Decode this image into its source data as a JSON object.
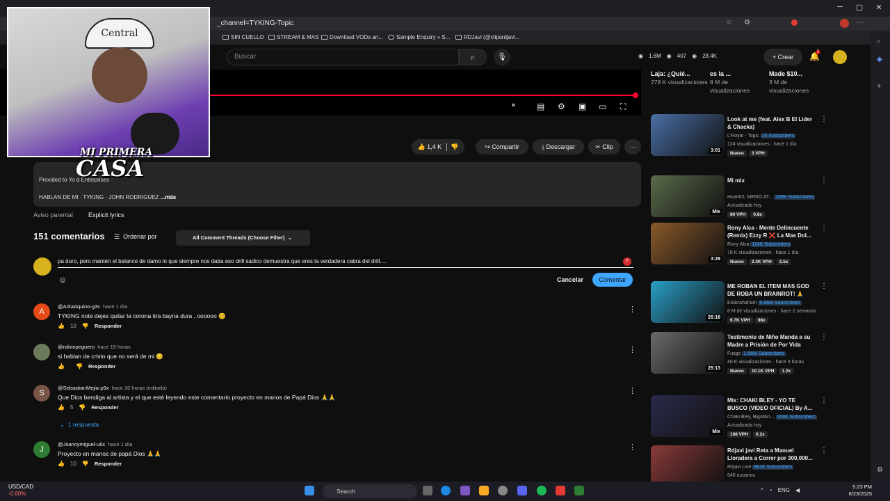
{
  "browser": {
    "url": "_channel=TYKING-Topic",
    "bookmarks": [
      "SIN CUELLO",
      "STREAM & MAS",
      "Download VODs an...",
      "Sample Enquiry » S...",
      "RDJavi (@clipsrdjavi..."
    ]
  },
  "header": {
    "search_placeholder": "Buscar",
    "stats": [
      "1.6M",
      "407",
      "28.4K"
    ],
    "create_label": "Crear",
    "notif_count": "5"
  },
  "actions": {
    "likes": "1,4 K",
    "share": "Compartir",
    "download": "Descargar",
    "clip": "Clip"
  },
  "description": {
    "line1": "Provided to Yo                                          d Enterprises",
    "line2": "HABLAN DE MI · TYKING · JOHN RODRIGUEZ",
    "more": "...más"
  },
  "overlay": {
    "line1": "MI PRIMERA",
    "line2": "CASA",
    "cap_text": "Central"
  },
  "aviso": "Aviso parental",
  "explicit": "Explicit lyrics",
  "comments": {
    "count_label": "151 comentarios",
    "order_label": "Ordenar por",
    "filter_label": "All Comment Threads (Choose Filter)",
    "draft": "pa duro, pero manten el balance de damo lo que siempre nos daba eso drill sadico demuestra que eres la verdadera cabra del drill....",
    "draft_badge": "7",
    "cancel": "Cancelar",
    "submit": "Comentar",
    "reply_label": "Responder",
    "replies_toggle": "1 respuesta",
    "items": [
      {
        "initial": "A",
        "color": "#e64a19",
        "user": "@AritaAquino-g3v",
        "time": "hace 1 día",
        "text": "TYKING note dejes quitar la corona tira bayna dura , oooooo 😊",
        "likes": "10"
      },
      {
        "initial": "",
        "color": "#6b7a5a",
        "user": "@ralvinpeguero",
        "time": "hace 15 horas",
        "text": "si hablan de cristo que no será de mi 😊",
        "likes": ""
      },
      {
        "initial": "S",
        "color": "#795548",
        "user": "@SebastianMejia-p9x",
        "time": "hace 20 horas (editado)",
        "text": "Que Dios bendiga al artista y el que esté leyendo este comentario proyecto en manos de Papá Dios 🙏🙏",
        "likes": "5"
      },
      {
        "initial": "J",
        "color": "#2e7d32",
        "user": "@Joancymiguel-u6x",
        "time": "hace 1 día",
        "text": "Proyecto en manos de papá Dios 🙏🙏",
        "likes": "10"
      }
    ]
  },
  "recommendations_top": [
    {
      "title": "Laja: ¿Quié...",
      "views": "278 K visualizaciones"
    },
    {
      "title": "es la ...",
      "views": "8 M de visualizaciones"
    },
    {
      "title": "Made $10...",
      "views": "3 M de visualizaciones"
    }
  ],
  "recommendations": [
    {
      "title": "Look at me (feat. Alex B El Lider & Chacka)",
      "channel": "L'Royal - Topic",
      "subs": "20 Subscribers",
      "meta": "124 visualizaciones · hace 1 día",
      "duration": "3:01",
      "badges": [
        "Nuevo",
        "3 VPH"
      ],
      "color": "#4a6fa5"
    },
    {
      "title": "Mi mix",
      "channel": "Huan62, MEMO AT...",
      "subs": "109K Subscribers",
      "meta": "Actualizada hoy",
      "duration": "Mix",
      "badges": [
        "80 VPH",
        "0.8x"
      ],
      "color": "#5a6b4a"
    },
    {
      "title": "Rony Alca - Mente Delincuente (Remix) Ezzy R ❌ La Mas Dol...",
      "channel": "Rony Alca",
      "subs": "114K Subscribers",
      "meta": "78 K visualizaciones · hace 1 día",
      "duration": "3:29",
      "badges": [
        "Nuevo",
        "2.3K VPH",
        "2.5x"
      ],
      "color": "#8a5a2a"
    },
    {
      "title": "ME ROBAN EL ITEM MAS GOD DE ROBA UN BRAINROT! 🙏",
      "channel": "ElAbrahaham",
      "subs": "5.86M Subscribers",
      "meta": "6 M de visualizaciones · hace 2 semanas",
      "duration": "26:18",
      "badges": [
        "6.7K VPH",
        "98x"
      ],
      "color": "#2aa0c8"
    },
    {
      "title": "Testimonio de Niño Manda a su Madre a Prisión de Por Vida",
      "channel": "Fusgo",
      "subs": "1.56M Subscribers",
      "meta": "40 K visualizaciones · hace 3 horas",
      "duration": "25:13",
      "badges": [
        "Nuevo",
        "10.1K VPH",
        "1.2x"
      ],
      "color": "#6a6a6a"
    },
    {
      "title": "Mix: CHAKI BLEY - YO TE BUSCO (VIDEO OFICIAL) By A...",
      "channel": "Chaki Bley, Bigoblin...",
      "subs": "208K Subscribers",
      "meta": "Actualizada hoy",
      "duration": "Mix",
      "badges": [
        "198 VPH",
        "0.2x"
      ],
      "color": "#2a2a4a"
    },
    {
      "title": "Rdjavi javi Reta a Manuel Lloradera a Correr por 300,000...",
      "channel": "Rdjavi Live",
      "subs": "961K Subscribers",
      "meta": "546 usuarios",
      "duration": "",
      "badges": [],
      "color": "#8a3a3a"
    }
  ],
  "taskbar": {
    "ticker": "USD/CAD",
    "change": "-0.60%",
    "search": "Search",
    "lang": "ENG",
    "time": "5:23 PM",
    "date": "8/23/2025"
  }
}
